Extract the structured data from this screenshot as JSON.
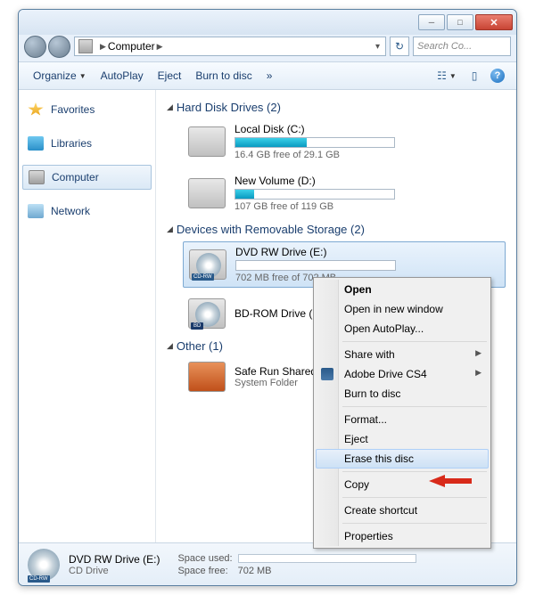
{
  "breadcrumb": {
    "root_icon": "computer",
    "path": "Computer",
    "chevron": "▶"
  },
  "search": {
    "placeholder": "Search Co..."
  },
  "toolbar": {
    "organize": "Organize",
    "autoplay": "AutoPlay",
    "eject": "Eject",
    "burn": "Burn to disc",
    "overflow": "»"
  },
  "sidebar": {
    "favorites": "Favorites",
    "libraries": "Libraries",
    "computer": "Computer",
    "network": "Network"
  },
  "sections": {
    "hdd": {
      "title": "Hard Disk Drives (2)"
    },
    "removable": {
      "title": "Devices with Removable Storage (2)"
    },
    "other": {
      "title": "Other (1)"
    }
  },
  "drives": {
    "c": {
      "name": "Local Disk (C:)",
      "free": "16.4 GB free of 29.1 GB",
      "fill_pct": 45
    },
    "d": {
      "name": "New Volume (D:)",
      "free": "107 GB free of 119 GB",
      "fill_pct": 12
    },
    "e": {
      "name": "DVD RW Drive (E:)",
      "free": "702 MB free of 702 MB",
      "fill_pct": 0
    },
    "g": {
      "name": "BD-ROM Drive (G:)"
    },
    "shared": {
      "name": "Safe Run Shared Fo",
      "sub": "System Folder"
    }
  },
  "context_menu": {
    "open": "Open",
    "open_new": "Open in new window",
    "open_autoplay": "Open AutoPlay...",
    "share": "Share with",
    "adobe": "Adobe Drive CS4",
    "burn": "Burn to disc",
    "format": "Format...",
    "eject": "Eject",
    "erase": "Erase this disc",
    "copy": "Copy",
    "shortcut": "Create shortcut",
    "properties": "Properties"
  },
  "statusbar": {
    "name": "DVD RW Drive (E:)",
    "type": "CD Drive",
    "used_label": "Space used:",
    "free_label": "Space free:",
    "free_value": "702 MB"
  }
}
